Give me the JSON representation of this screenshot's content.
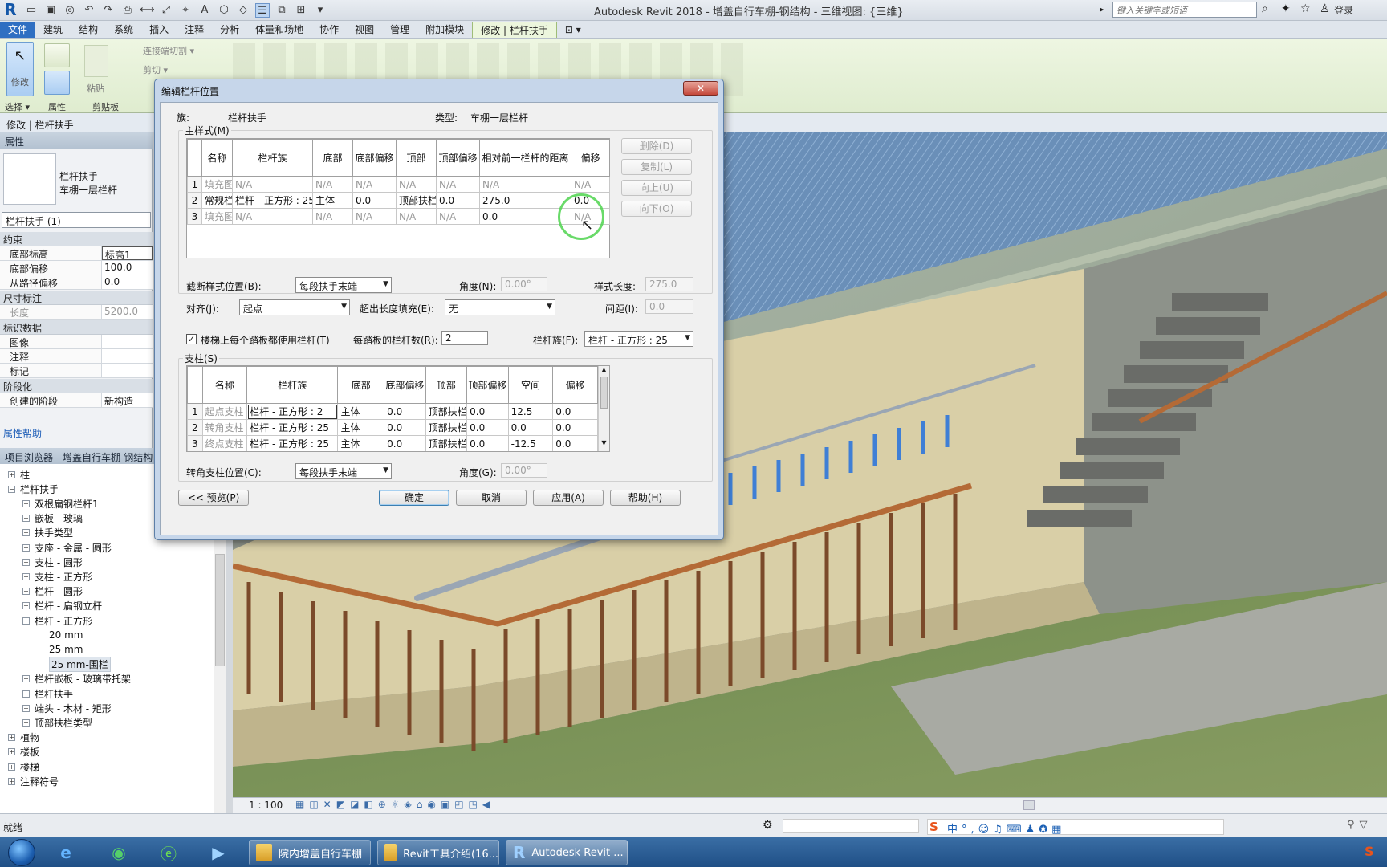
{
  "app": {
    "title": "Autodesk Revit 2018 -    增盖自行车棚-钢结构 - 三维视图: {三维}",
    "search_placeholder": "键入关键字或短语",
    "login": "登录",
    "logo": "R"
  },
  "ribbon_tabs": [
    "文件",
    "建筑",
    "结构",
    "系统",
    "插入",
    "注释",
    "分析",
    "体量和场地",
    "协作",
    "视图",
    "管理",
    "附加模块",
    "修改 | 栏杆扶手"
  ],
  "ribbon": {
    "modify": "修改",
    "select": "选择 ▾",
    "properties": "属性",
    "clipboard": "剪贴板",
    "paste": "粘贴",
    "cut_join": "连接端切割 ▾",
    "cut": "剪切 ▾"
  },
  "context_bar": "修改 | 栏杆扶手",
  "properties": {
    "header": "属性",
    "type_family": "栏杆扶手",
    "type_name": "车棚一层栏杆",
    "instance_select": "栏杆扶手 (1)",
    "sections": {
      "constraints": "约束",
      "dimensions": "尺寸标注",
      "identity": "标识数据",
      "phasing": "阶段化"
    },
    "rows": {
      "base_level": {
        "k": "底部标高",
        "v": "标高1"
      },
      "base_offset": {
        "k": "底部偏移",
        "v": "100.0"
      },
      "path_offset": {
        "k": "从路径偏移",
        "v": "0.0"
      },
      "length": {
        "k": "长度",
        "v": "5200.0"
      },
      "image": {
        "k": "图像",
        "v": ""
      },
      "comments": {
        "k": "注释",
        "v": ""
      },
      "mark": {
        "k": "标记",
        "v": ""
      },
      "phase_created": {
        "k": "创建的阶段",
        "v": "新构造"
      }
    },
    "help": "属性帮助"
  },
  "browser": {
    "header": "项目浏览器 - 增盖自行车棚-钢结构",
    "items": [
      {
        "label": "柱",
        "level": 1,
        "pm": "+"
      },
      {
        "label": "栏杆扶手",
        "level": 1,
        "pm": "−"
      },
      {
        "label": "双根扁钢栏杆1",
        "level": 2,
        "pm": "+"
      },
      {
        "label": "嵌板 - 玻璃",
        "level": 2,
        "pm": "+"
      },
      {
        "label": "扶手类型",
        "level": 2,
        "pm": "+"
      },
      {
        "label": "支座 - 金属 - 圆形",
        "level": 2,
        "pm": "+"
      },
      {
        "label": "支柱 - 圆形",
        "level": 2,
        "pm": "+"
      },
      {
        "label": "支柱 - 正方形",
        "level": 2,
        "pm": "+"
      },
      {
        "label": "栏杆 - 圆形",
        "level": 2,
        "pm": "+"
      },
      {
        "label": "栏杆 - 扁钢立杆",
        "level": 2,
        "pm": "+"
      },
      {
        "label": "栏杆 - 正方形",
        "level": 2,
        "pm": "−"
      },
      {
        "label": "20 mm",
        "level": 3,
        "pm": ""
      },
      {
        "label": "25 mm",
        "level": 3,
        "pm": ""
      },
      {
        "label": "25 mm-围栏",
        "level": 3,
        "pm": "",
        "selected": true
      },
      {
        "label": "栏杆嵌板 - 玻璃带托架",
        "level": 2,
        "pm": "+"
      },
      {
        "label": "栏杆扶手",
        "level": 2,
        "pm": "+"
      },
      {
        "label": "端头 - 木材 - 矩形",
        "level": 2,
        "pm": "+"
      },
      {
        "label": "顶部扶栏类型",
        "level": 2,
        "pm": "+"
      },
      {
        "label": "植物",
        "level": 1,
        "pm": "+"
      },
      {
        "label": "楼板",
        "level": 1,
        "pm": "+"
      },
      {
        "label": "楼梯",
        "level": 1,
        "pm": "+"
      },
      {
        "label": "注释符号",
        "level": 1,
        "pm": "+"
      }
    ]
  },
  "viewbar": {
    "scale": "1 : 100"
  },
  "status": {
    "text": "就绪"
  },
  "taskbar": {
    "tasks": [
      {
        "label": "院内增盖自行车棚"
      },
      {
        "label": "Revit工具介绍(16..."
      },
      {
        "label": "Autodesk Revit ..."
      }
    ]
  },
  "dialog": {
    "title": "编辑栏杆位置",
    "close": "✕",
    "family_label": "族:",
    "family_value": "栏杆扶手",
    "type_label": "类型:",
    "type_value": "车棚一层栏杆",
    "main_pattern_label": "主样式(M)",
    "main_cols": [
      "",
      "名称",
      "栏杆族",
      "底部",
      "底部偏移",
      "顶部",
      "顶部偏移",
      "相对前一栏杆的距离",
      "偏移"
    ],
    "main_rows": [
      [
        "1",
        "填充图",
        "N/A",
        "N/A",
        "N/A",
        "N/A",
        "N/A",
        "N/A",
        "N/A"
      ],
      [
        "2",
        "常规栏",
        "栏杆 - 正方形 : 25",
        "主体",
        "0.0",
        "顶部扶栏",
        "0.0",
        "275.0",
        "0.0"
      ],
      [
        "3",
        "填充图",
        "N/A",
        "N/A",
        "N/A",
        "N/A",
        "N/A",
        "0.0",
        "N/A"
      ]
    ],
    "side_buttons": [
      "删除(D)",
      "复制(L)",
      "向上(U)",
      "向下(O)"
    ],
    "break_label": "截断样式位置(B):",
    "break_value": "每段扶手末端",
    "angle_label": "角度(N):",
    "angle_value": "0.00°",
    "pattern_length_label": "样式长度:",
    "pattern_length_value": "275.0",
    "justify_label": "对齐(J):",
    "justify_value": "起点",
    "excess_label": "超出长度填充(E):",
    "excess_value": "无",
    "spacing_label": "间距(I):",
    "spacing_value": "0.0",
    "use_baluster_label": "楼梯上每个踏板都使用栏杆(T)",
    "per_tread_label": "每踏板的栏杆数(R):",
    "per_tread_value": "2",
    "baluster_family_label": "栏杆族(F):",
    "baluster_family_value": "栏杆 - 正方形 : 25",
    "posts_label": "支柱(S)",
    "post_cols": [
      "",
      "名称",
      "栏杆族",
      "底部",
      "底部偏移",
      "顶部",
      "顶部偏移",
      "空间",
      "偏移"
    ],
    "post_rows": [
      [
        "1",
        "起点支柱",
        "栏杆 - 正方形 : 2",
        "主体",
        "0.0",
        "顶部扶栏",
        "0.0",
        "12.5",
        "0.0"
      ],
      [
        "2",
        "转角支柱",
        "栏杆 - 正方形 : 25",
        "主体",
        "0.0",
        "顶部扶栏",
        "0.0",
        "0.0",
        "0.0"
      ],
      [
        "3",
        "终点支柱",
        "栏杆 - 正方形 : 25",
        "主体",
        "0.0",
        "顶部扶栏",
        "0.0",
        "-12.5",
        "0.0"
      ]
    ],
    "corner_label": "转角支柱位置(C):",
    "corner_value": "每段扶手末端",
    "corner_angle_label": "角度(G):",
    "corner_angle_value": "0.00°",
    "preview": "<< 预览(P)",
    "ok": "确定",
    "cancel": "取消",
    "apply": "应用(A)",
    "help": "帮助(H)"
  }
}
